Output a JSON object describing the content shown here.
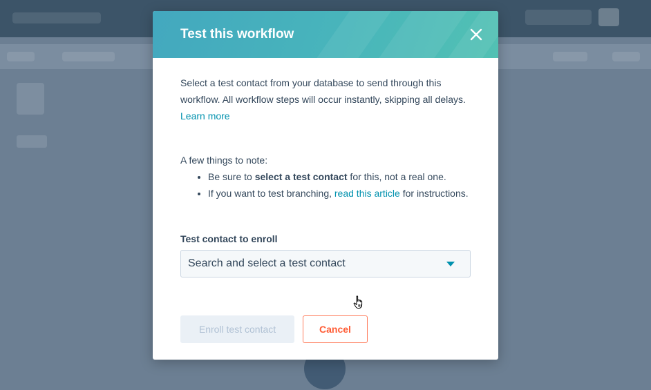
{
  "modal": {
    "title": "Test this workflow",
    "intro_text": "Select a test contact from your database to send through this workflow. All workflow steps will occur instantly, skipping all delays. ",
    "learn_more_link": "Learn more",
    "notes_heading": "A few things to note:",
    "note_1": {
      "prefix": "Be sure to ",
      "bold": "select a test contact",
      "suffix": " for this, not a real one."
    },
    "note_2": {
      "prefix": "If you want to test branching, ",
      "link": "read this article",
      "suffix": " for instructions."
    },
    "field_label": "Test contact to enroll",
    "select_placeholder": "Search and select a test contact",
    "enroll_button": "Enroll test contact",
    "cancel_button": "Cancel"
  },
  "icons": {
    "close": "close-icon",
    "caret": "caret-down-icon",
    "cursor": "hand-pointer-icon"
  },
  "colors": {
    "header_gradient_start": "#43a8bf",
    "header_gradient_end": "#52c1b3",
    "link": "#0091ae",
    "cancel": "#ff5c35",
    "text": "#33475b",
    "disabled_bg": "#eaf0f6",
    "disabled_text": "#b0c1d4"
  }
}
